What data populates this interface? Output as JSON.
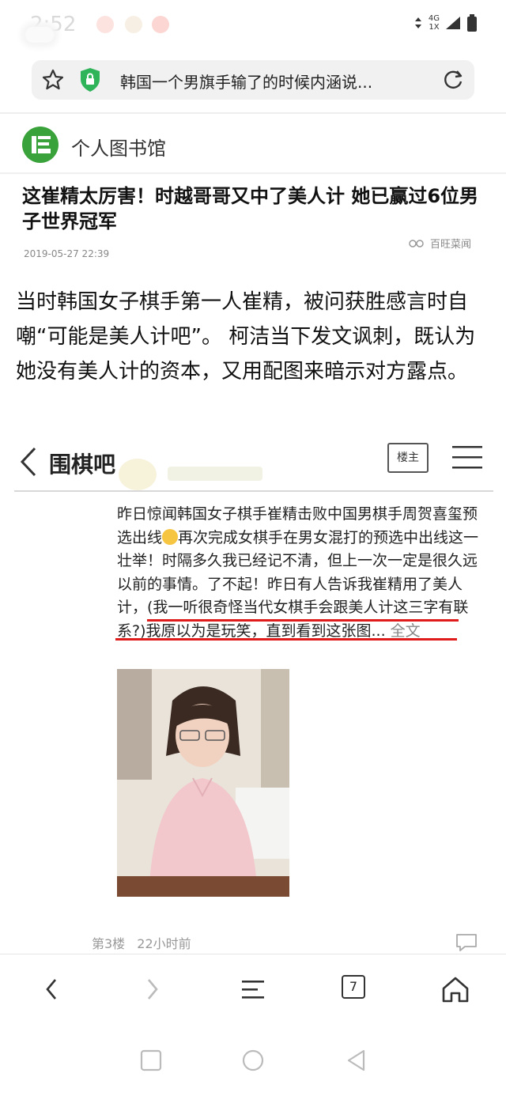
{
  "status_bar": {
    "time": "2:52",
    "network_top": "4G",
    "network_bottom": "1X"
  },
  "address_bar": {
    "url_title": "韩国一个男旗手输了的时候内涵说..."
  },
  "site": {
    "name": "个人图书馆"
  },
  "article": {
    "headline": "这崔精太厉害！时越哥哥又中了美人计 她已赢过6位男子世界冠军",
    "date": "2019-05-27 22:39",
    "source": "百旺菜闻",
    "paragraph": "当时韩国女子棋手第一人崔精，被问获胜感言时自嘲“可能是美人计吧”。 柯洁当下发文讽刺，既认为她没有美人计的资本，又用配图来暗示对方露点。"
  },
  "forum": {
    "title": "围棋吧",
    "owner_button": "楼主",
    "post_part1": "昨日惊闻韩国女子棋手崔精击败中国男棋手周贺喜玺预选出线",
    "post_part2": "再次完成女棋手在男女混打的预选中出线这一壮举！时隔多久我已经记不清，但上一次一定是很久远以前的事情。了不起！昨日有人告诉我崔精用了美人计，(我一听很奇怪当代女棋手会跟美人计这三字有联系?)我原以为是玩笑，直到看到这张图...",
    "post_more": "全文",
    "floor": "第3楼",
    "time_ago": "22小时前"
  },
  "toolbar": {
    "tab_count": "7"
  },
  "colors": {
    "accent_green": "#3aa23a",
    "underline_red": "#e01b1b",
    "shield_green": "#2fb45a"
  },
  "icons": [
    "star-icon",
    "shield-lock-icon",
    "refresh-icon",
    "back-icon",
    "forward-icon",
    "menu-icon",
    "home-icon",
    "square-icon",
    "circle-icon",
    "triangle-back-icon",
    "comment-icon"
  ]
}
